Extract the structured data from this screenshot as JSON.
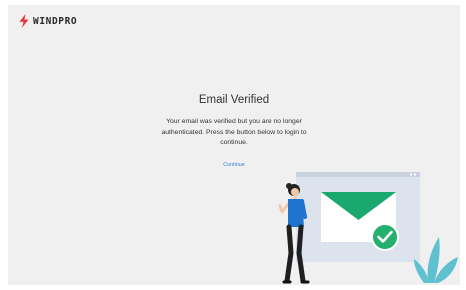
{
  "brand": {
    "name": "WINDPRO",
    "accent": "#e8333a"
  },
  "main": {
    "title": "Email Verified",
    "message": "Your email was verified but you are no longer authenticated. Press the button below to login to continue.",
    "continue_label": "Continue"
  },
  "colors": {
    "link": "#3a7fd6",
    "envelope": "#1aa86e",
    "check": "#26b06f",
    "plant": "#5fc0d0",
    "shirt": "#1e74cf"
  },
  "illustration": {
    "icon": "email-verified-illustration"
  }
}
